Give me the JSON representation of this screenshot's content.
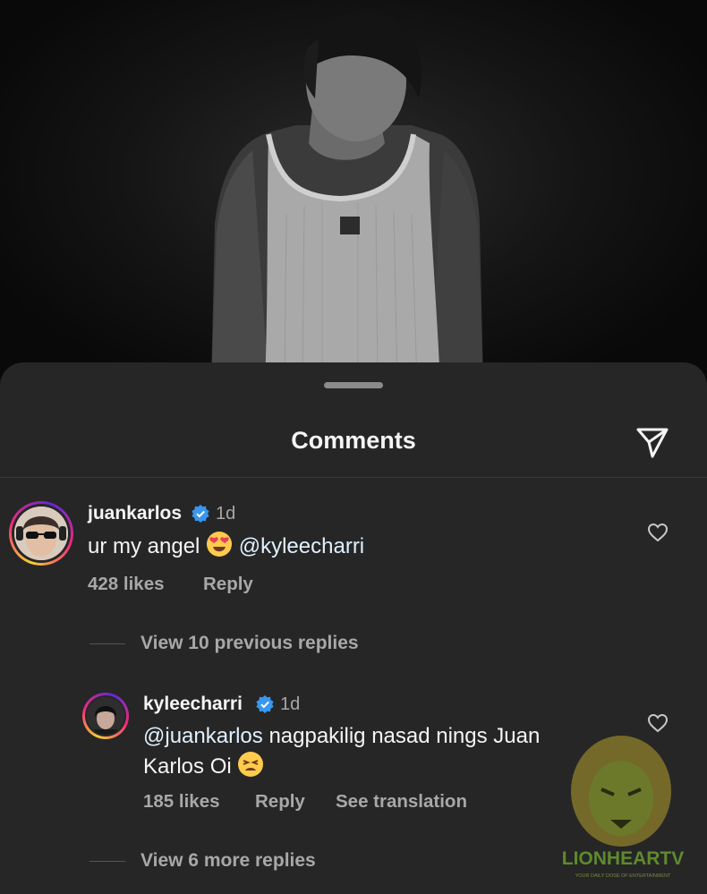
{
  "header": {
    "title": "Comments"
  },
  "icons": {
    "share": "paper-plane-icon",
    "like": "heart-outline-icon",
    "verified": "verified-badge-icon"
  },
  "colors": {
    "sheet": "#262626",
    "verified": "#3897f0",
    "secondary_text": "#a8a8a8"
  },
  "comments": [
    {
      "username": "juankarlos",
      "time": "1d",
      "text_before": "ur my angel",
      "emoji": "😍",
      "mention": "@kyleecharri",
      "likes": "428 likes",
      "reply": "Reply",
      "view_replies": "View 10 previous replies"
    }
  ],
  "replies": [
    {
      "username": "kyleecharri",
      "time": "1d",
      "mention": "@juankarlos",
      "text_line1": "nagpakilig nasad nings Juan",
      "text_line2": "Karlos Oi",
      "emoji": "😫",
      "likes": "185 likes",
      "reply": "Reply",
      "translate": "See translation",
      "view_more": "View 6 more replies"
    }
  ],
  "watermark": {
    "brand": "LIONHEARTV",
    "tagline": "YOUR DAILY DOSE OF ENTERTAINMENT"
  }
}
